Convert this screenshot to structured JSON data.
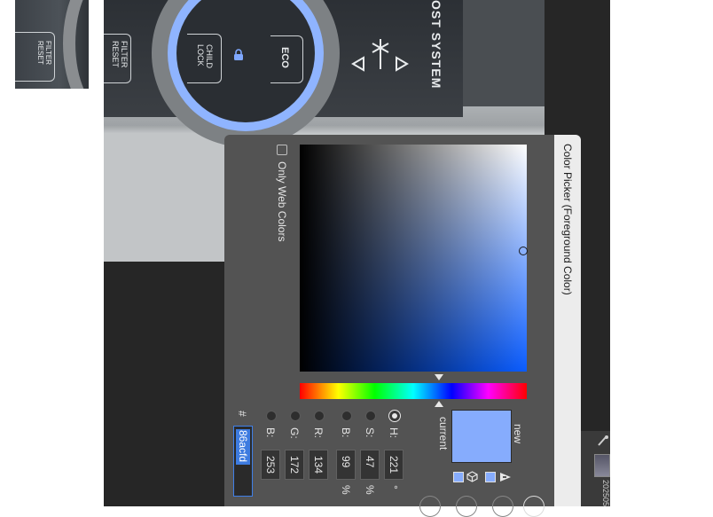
{
  "photo": {
    "panel_labels": [
      "FILTER RESET",
      "CHILD LOCK",
      "ECO"
    ],
    "defrost_text": "OST SYSTEM",
    "small_labels": [
      "FILTER RESET"
    ]
  },
  "dialog": {
    "title": "Color Picker (Foreground Color)",
    "only_web_colors_label": "Only Web Colors",
    "new_label": "new",
    "current_label": "current",
    "new_color": "#86acfd",
    "current_color": "#86acfd",
    "fields": [
      {
        "key": "H",
        "label": "H:",
        "value": "221",
        "unit": "°",
        "selected": true
      },
      {
        "key": "S",
        "label": "S:",
        "value": "47",
        "unit": "%",
        "selected": false
      },
      {
        "key": "Bv",
        "label": "B:",
        "value": "99",
        "unit": "%",
        "selected": false
      },
      {
        "key": "R",
        "label": "R:",
        "value": "134",
        "unit": "",
        "selected": false
      },
      {
        "key": "G",
        "label": "G:",
        "value": "172",
        "unit": "",
        "selected": false
      },
      {
        "key": "Bl",
        "label": "B:",
        "value": "253",
        "unit": "",
        "selected": false
      }
    ],
    "hex_label": "#",
    "hex_value": "86acfd",
    "field_hue_color": "#0a5cff"
  },
  "background_app": {
    "file_label": "202505"
  }
}
